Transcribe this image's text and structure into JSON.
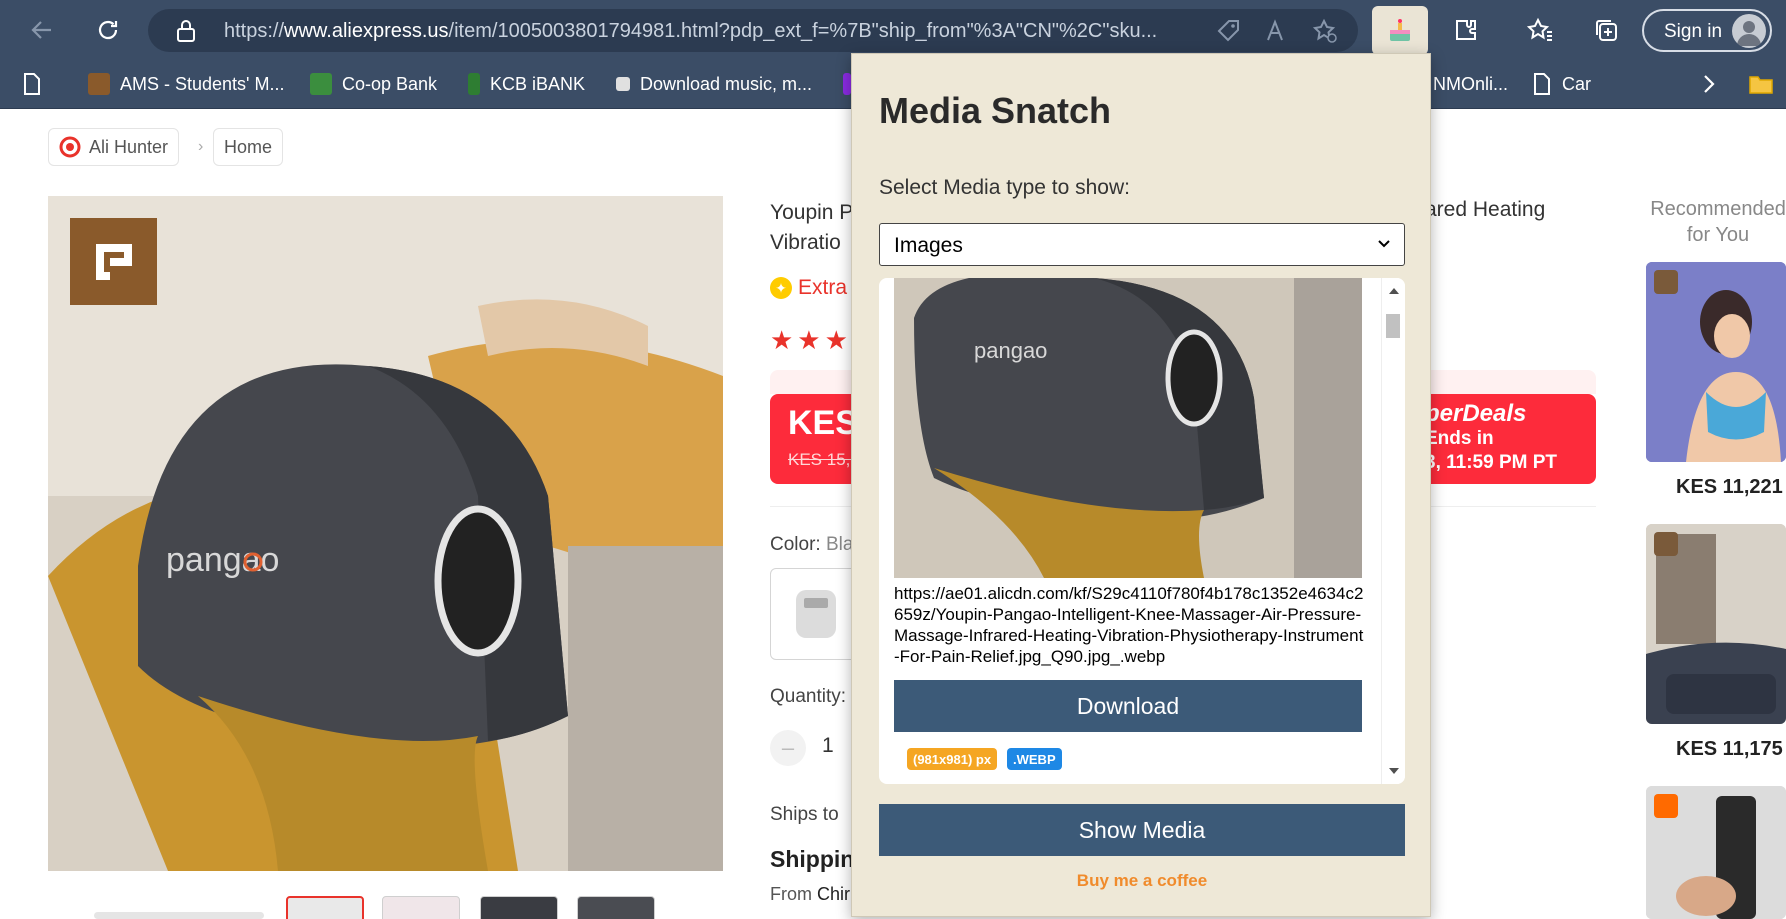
{
  "browser": {
    "url_prefix": "https://",
    "url_host": "www.aliexpress.us",
    "url_rest": "/item/1005003801794981.html?pdp_ext_f=%7B\"ship_from\"%3A\"CN\"%2C\"sku...",
    "signin_label": "Sign in"
  },
  "favorites": [
    {
      "label": "AMS - Students' M...",
      "color": "#8a5a2b"
    },
    {
      "label": "Co-op Bank",
      "color": "#3b8e3e"
    },
    {
      "label": "KCB iBANK",
      "color": "#2e7d32"
    },
    {
      "label": "Download music, m...",
      "color": "#e0e0e0"
    },
    {
      "label": "NMOnli...",
      "color": "#8a2be2"
    },
    {
      "label": "Car",
      "color": "#ffffff"
    }
  ],
  "page": {
    "breadcrumb": [
      "Ali Hunter",
      "Home"
    ],
    "title_start": "Youpin P",
    "title_start_line2": "Vibratio",
    "title_end": "ared Heating",
    "extra_label": "Extra",
    "stars": "★★★",
    "price": "KES",
    "old_price": "KES 15,0",
    "superdeals": "perDeals",
    "ends_in": "Ends in",
    "end_time": "3, 11:59 PM PT",
    "color_label": "Color:",
    "color_value": "Bla",
    "quantity_label": "Quantity:",
    "quantity_value": "1",
    "ships_to": "Ships to",
    "shipping": "Shippin",
    "from": "From",
    "from_value": "Chir"
  },
  "recommended": {
    "heading": "Recommended for You",
    "items": [
      {
        "price": "KES 11,221"
      },
      {
        "price": "KES 11,175"
      }
    ]
  },
  "popup": {
    "title": "Media Snatch",
    "select_label": "Select Media type to show:",
    "select_value": "Images",
    "media_url": "https://ae01.alicdn.com/kf/S29c4110f780f4b178c1352e4634c2659z/Youpin-Pangao-Intelligent-Knee-Massager-Air-Pressure-Massage-Infrared-Heating-Vibration-Physiotherapy-Instrument-For-Pain-Relief.jpg_Q90.jpg_.webp",
    "download_label": "Download",
    "size_tag": "(981x981) px",
    "format_tag": ".WEBP",
    "show_media_label": "Show Media",
    "coffee_label": "Buy me a coffee",
    "colors": {
      "button": "#3c5a78",
      "size_tag": "#f5a623",
      "format_tag": "#1e88e5",
      "coffee": "#f08b2c"
    }
  },
  "product_brand_text": "pangao"
}
